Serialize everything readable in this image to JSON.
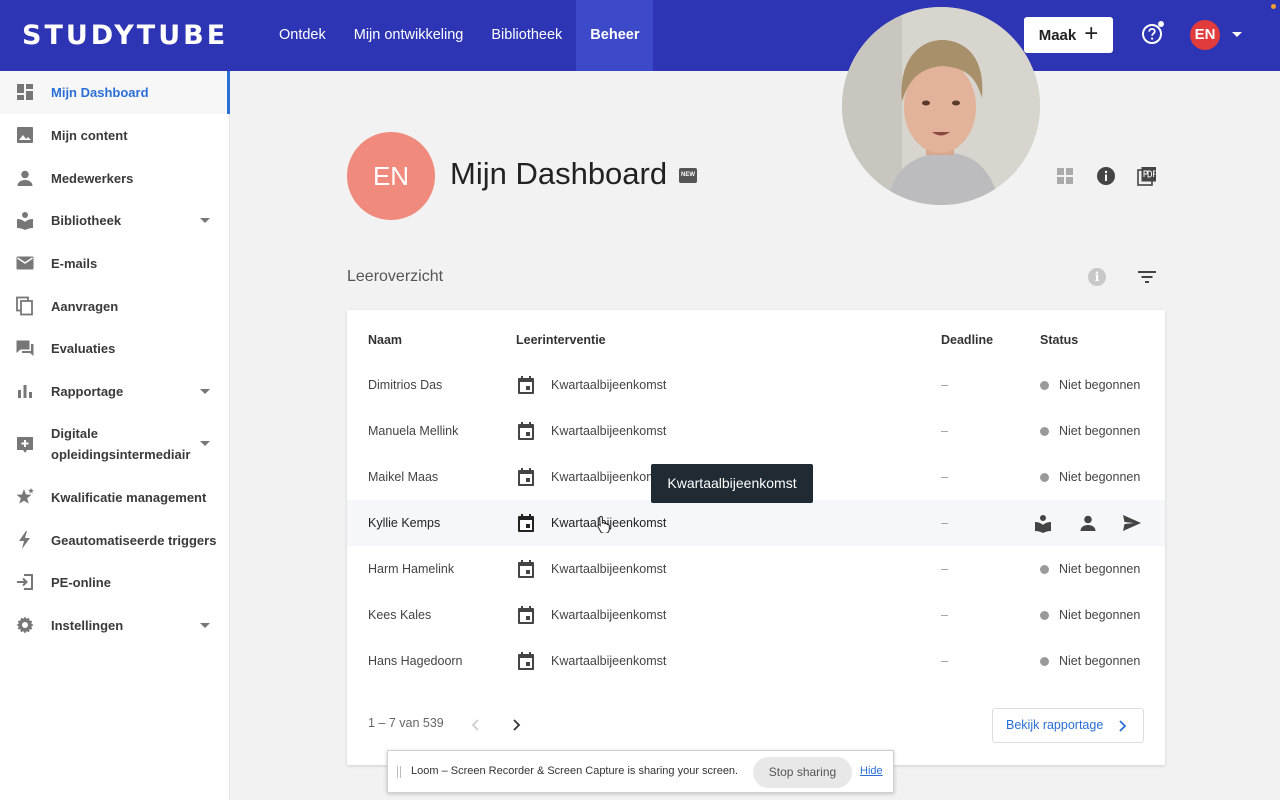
{
  "topbar": {
    "logo": "STUDYTUBE",
    "nav": [
      "Ontdek",
      "Mijn ontwikkeling",
      "Bibliotheek",
      "Beheer"
    ],
    "active_nav": "Beheer",
    "create_label": "Maak",
    "user_initials": "EN",
    "color": "#2d35b5"
  },
  "sidebar": {
    "items": [
      {
        "label": "Mijn Dashboard",
        "icon": "dashboard-icon",
        "active": true
      },
      {
        "label": "Mijn content",
        "icon": "image-icon"
      },
      {
        "label": "Medewerkers",
        "icon": "person-icon"
      },
      {
        "label": "Bibliotheek",
        "icon": "library-icon",
        "expandable": true
      },
      {
        "label": "E-mails",
        "icon": "mail-icon"
      },
      {
        "label": "Aanvragen",
        "icon": "copy-icon"
      },
      {
        "label": "Evaluaties",
        "icon": "chat-icon"
      },
      {
        "label": "Rapportage",
        "icon": "bar-chart-icon",
        "expandable": true
      },
      {
        "label": "Digitale",
        "label2": "opleidingsintermediair",
        "icon": "plus-box-icon",
        "expandable": true
      },
      {
        "label": "Kwalificatie management",
        "icon": "stars-icon"
      },
      {
        "label": "Geautomatiseerde triggers",
        "icon": "bolt-icon"
      },
      {
        "label": "PE-online",
        "icon": "login-icon"
      },
      {
        "label": "Instellingen",
        "icon": "gear-icon",
        "expandable": true
      }
    ]
  },
  "header": {
    "initials": "EN",
    "title": "Mijn Dashboard",
    "badge": "NEW"
  },
  "section": {
    "title": "Leeroverzicht"
  },
  "table": {
    "columns": [
      "Naam",
      "Leerinterventie",
      "Deadline",
      "Status"
    ],
    "rows": [
      {
        "name": "Dimitrios Das",
        "intervention": "Kwartaalbijeenkomst",
        "deadline": "–",
        "status": "Niet begonnen"
      },
      {
        "name": "Manuela Mellink",
        "intervention": "Kwartaalbijeenkomst",
        "deadline": "–",
        "status": "Niet begonnen"
      },
      {
        "name": "Maikel Maas",
        "intervention": "Kwartaalbijeenkomst",
        "deadline": "–",
        "status": "Niet begonnen"
      },
      {
        "name": "Kyllie Kemps",
        "intervention": "Kwartaalbijeenkomst",
        "deadline": "–",
        "status": "",
        "hovered": true
      },
      {
        "name": "Harm Hamelink",
        "intervention": "Kwartaalbijeenkomst",
        "deadline": "–",
        "status": "Niet begonnen"
      },
      {
        "name": "Kees Kales",
        "intervention": "Kwartaalbijeenkomst",
        "deadline": "–",
        "status": "Niet begonnen"
      },
      {
        "name": "Hans Hagedoorn",
        "intervention": "Kwartaalbijeenkomst",
        "deadline": "–",
        "status": "Niet begonnen"
      }
    ],
    "pagination": "1 – 7 van 539",
    "report_button": "Bekijk rapportage"
  },
  "tooltip": "Kwartaalbijeenkomst",
  "loom": {
    "message": "Loom – Screen Recorder & Screen Capture is sharing your screen.",
    "stop_label": "Stop sharing",
    "hide_label": "Hide"
  }
}
